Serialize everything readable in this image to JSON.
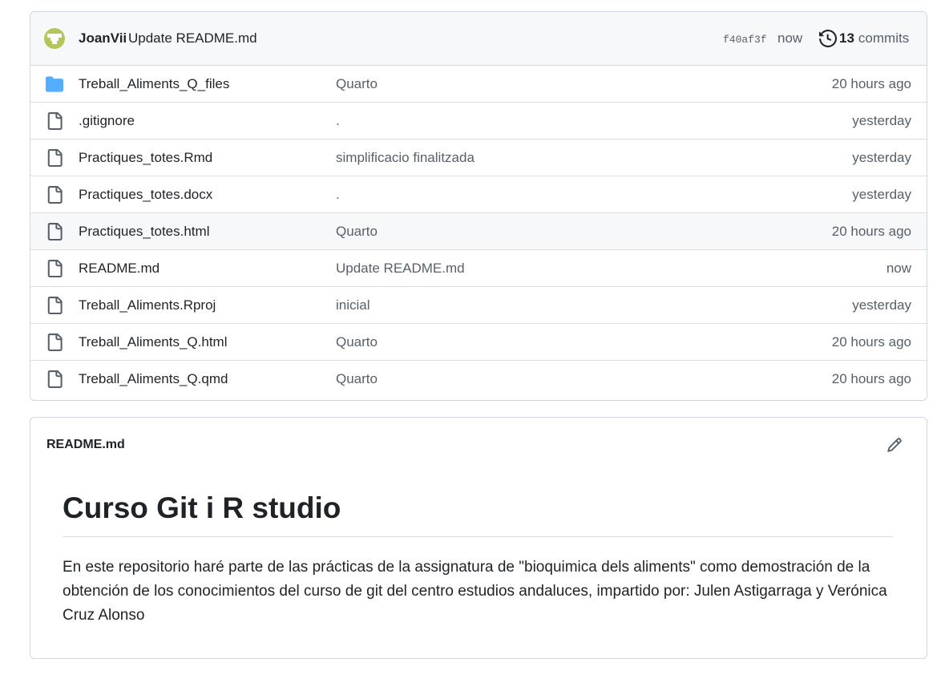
{
  "commit": {
    "author": "JoanVii",
    "message": "Update README.md",
    "sha": "f40af3f",
    "time": "now",
    "count": "13",
    "count_label": "commits",
    "avatar_color": "#b3c659"
  },
  "files": [
    {
      "name": "Treball_Aliments_Q_files",
      "message": "Quarto",
      "date": "20 hours ago",
      "icon": "folder-icon"
    },
    {
      "name": ".gitignore",
      "message": ".",
      "date": "yesterday",
      "icon": "file-icon"
    },
    {
      "name": "Practiques_totes.Rmd",
      "message": "simplificacio finalitzada",
      "date": "yesterday",
      "icon": "file-icon"
    },
    {
      "name": "Practiques_totes.docx",
      "message": ".",
      "date": "yesterday",
      "icon": "file-icon"
    },
    {
      "name": "Practiques_totes.html",
      "message": "Quarto",
      "date": "20 hours ago",
      "icon": "file-icon"
    },
    {
      "name": "README.md",
      "message": "Update README.md",
      "date": "now",
      "icon": "file-icon"
    },
    {
      "name": "Treball_Aliments.Rproj",
      "message": "inicial",
      "date": "yesterday",
      "icon": "file-icon"
    },
    {
      "name": "Treball_Aliments_Q.html",
      "message": "Quarto",
      "date": "20 hours ago",
      "icon": "file-icon"
    },
    {
      "name": "Treball_Aliments_Q.qmd",
      "message": "Quarto",
      "date": "20 hours ago",
      "icon": "file-icon"
    }
  ],
  "readme": {
    "title": "README.md",
    "heading": "Curso Git i R studio",
    "body": "En este repositorio haré parte de las prácticas de la assignatura de \"bioquimica dels aliments\" como demostración de la obtención de los conocimientos del curso de git del centro estudios andaluces, impartido por: Julen Astigarraga y Verónica Cruz Alonso"
  },
  "colors": {
    "folder": "#54aeff",
    "file": "#57606a",
    "border": "#d0d7de",
    "header_bg": "#f6f8fa"
  }
}
